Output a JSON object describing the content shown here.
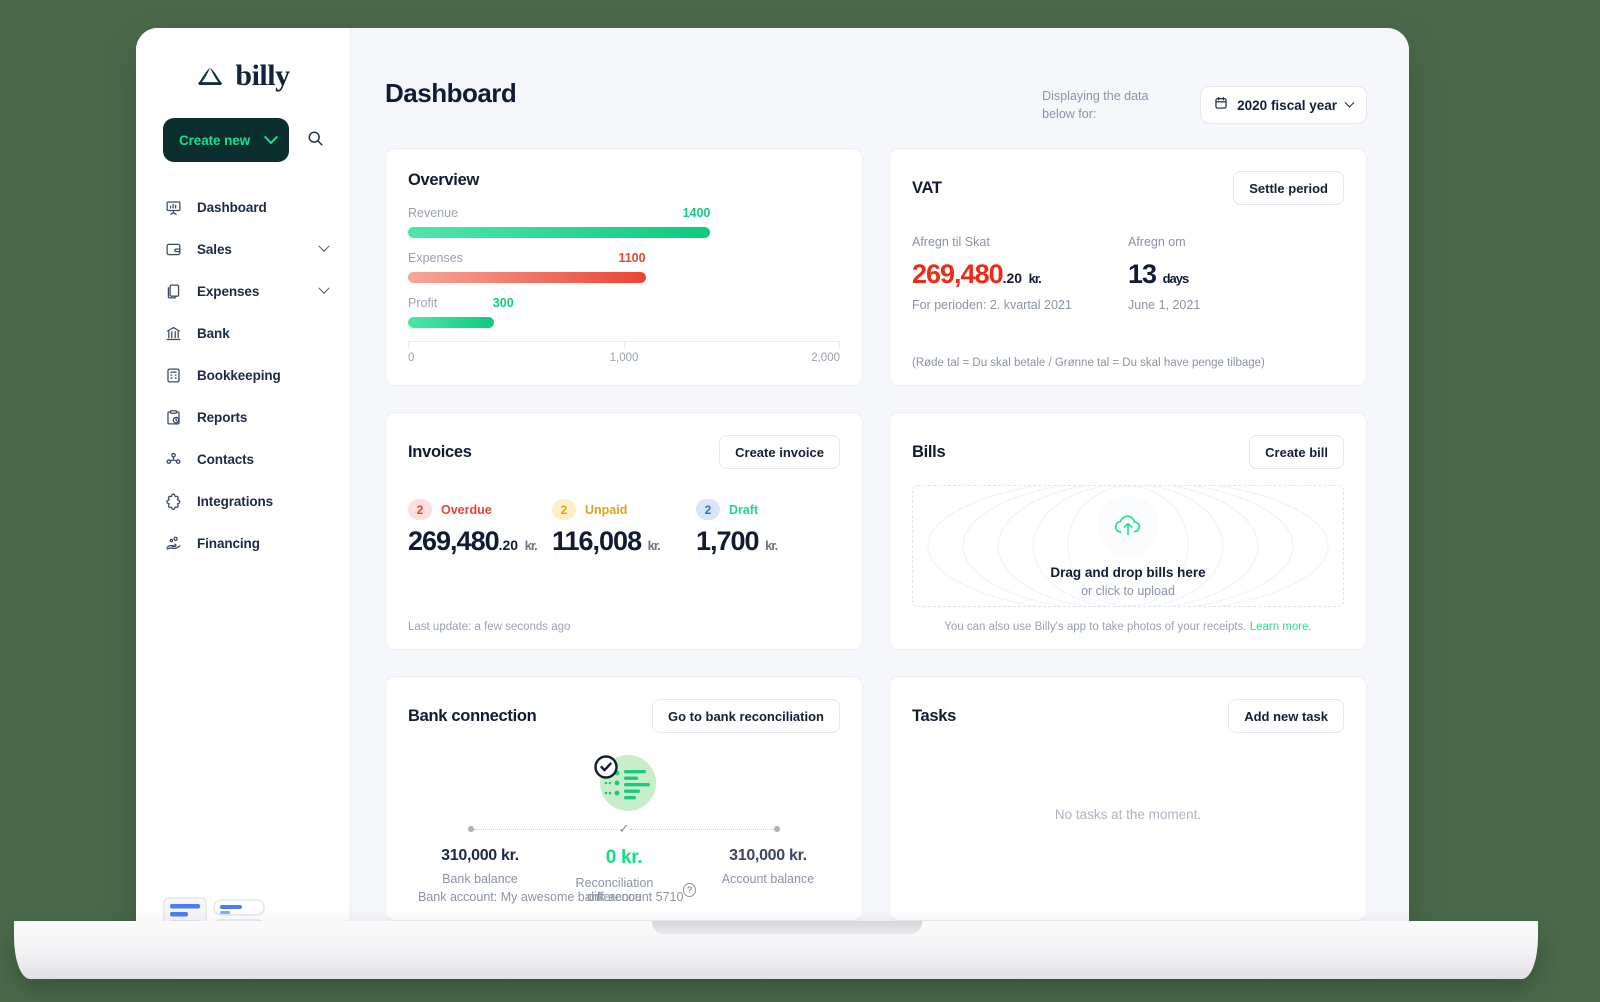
{
  "brand": {
    "name": "billy",
    "logo_icon": "billy-mark-icon"
  },
  "sidebar": {
    "create_new": {
      "label": "Create new",
      "chevron_icon": "chevron-down-icon"
    },
    "search_icon": "search-icon",
    "items": [
      {
        "label": "Dashboard",
        "icon": "presentation-chart-icon",
        "expandable": false
      },
      {
        "label": "Sales",
        "icon": "wallet-icon",
        "expandable": true
      },
      {
        "label": "Expenses",
        "icon": "documents-icon",
        "expandable": true
      },
      {
        "label": "Bank",
        "icon": "bank-building-icon",
        "expandable": false
      },
      {
        "label": "Bookkeeping",
        "icon": "calculator-icon",
        "expandable": false
      },
      {
        "label": "Reports",
        "icon": "clipboard-clock-icon",
        "expandable": false
      },
      {
        "label": "Contacts",
        "icon": "people-icon",
        "expandable": false
      },
      {
        "label": "Integrations",
        "icon": "puzzle-icon",
        "expandable": false
      },
      {
        "label": "Financing",
        "icon": "hand-coins-icon",
        "expandable": false
      }
    ]
  },
  "header": {
    "title": "Dashboard",
    "displaying_label": "Displaying the data below for:",
    "fiscal_year": {
      "value": "2020 fiscal year",
      "calendar_icon": "calendar-icon",
      "chevron_icon": "chevron-down-icon"
    }
  },
  "overview": {
    "title": "Overview"
  },
  "chart_data": {
    "type": "bar",
    "title": "Overview",
    "orientation": "horizontal",
    "categories": [
      "Revenue",
      "Expenses",
      "Profit"
    ],
    "values": [
      1400,
      1100,
      300
    ],
    "value_labels": [
      "1400",
      "1100",
      "300"
    ],
    "colors": [
      "#11cd80",
      "#ec4433",
      "#11cd80"
    ],
    "xlabel": "",
    "ylabel": "",
    "xlim": [
      0,
      2000
    ],
    "ticks": [
      0,
      1000,
      2000
    ],
    "tick_labels": [
      "0",
      "1,000",
      "2,000"
    ],
    "grid": false,
    "legend": false
  },
  "vat": {
    "title": "VAT",
    "settle_button": "Settle period",
    "left": {
      "label": "Afregn til Skat",
      "amount": "269,480",
      "decimals": ".20",
      "unit": "kr.",
      "sub": "For perioden: 2. kvartal 2021",
      "color": "#ee2b18"
    },
    "right": {
      "label": "Afregn om",
      "amount": "13",
      "unit": "days",
      "sub": "June 1, 2021"
    },
    "note": "(Røde tal = Du skal betale / Grønne tal = Du skal have penge tilbage)"
  },
  "invoices": {
    "title": "Invoices",
    "create_button": "Create invoice",
    "stats": [
      {
        "count": "2",
        "status": "Overdue",
        "amount": "269,480",
        "decimals": ".20",
        "unit": "kr.",
        "pill_bg": "#fbdede",
        "pill_text": "#ea4335",
        "status_color": "#ea4335"
      },
      {
        "count": "2",
        "status": "Unpaid",
        "amount": "116,008",
        "decimals": "",
        "unit": "kr.",
        "pill_bg": "#fdf0c8",
        "pill_text": "#d9a417",
        "status_color": "#d9a417"
      },
      {
        "count": "2",
        "status": "Draft",
        "amount": "1,700",
        "decimals": "",
        "unit": "kr.",
        "pill_bg": "#d7e6fb",
        "pill_text": "#2f6fd0",
        "status_color": "#1fd98a"
      }
    ],
    "footer": "Last update: a few seconds ago"
  },
  "bills": {
    "title": "Bills",
    "create_button": "Create bill",
    "dropzone": {
      "upload_icon": "cloud-upload-icon",
      "title": "Drag and drop bills here",
      "sub": "or click to upload"
    },
    "footer_text": "You can also use Billy's app to take photos of your receipts. ",
    "footer_link": "Learn more."
  },
  "bank": {
    "title": "Bank connection",
    "action_button": "Go to bank reconciliation",
    "illustration_icon": "bank-sync-check-icon",
    "columns": [
      {
        "amount": "310,000 kr.",
        "label": "Bank balance"
      },
      {
        "amount": "0 kr.",
        "label": "Reconciliation difference",
        "help_icon": "question-icon",
        "color": "#10e080"
      },
      {
        "amount": "310,000 kr.",
        "label": "Account balance"
      }
    ],
    "account_note": "Bank account: My awesome bank account 5710"
  },
  "tasks": {
    "title": "Tasks",
    "add_button": "Add new task",
    "empty_text": "No tasks at the moment."
  }
}
